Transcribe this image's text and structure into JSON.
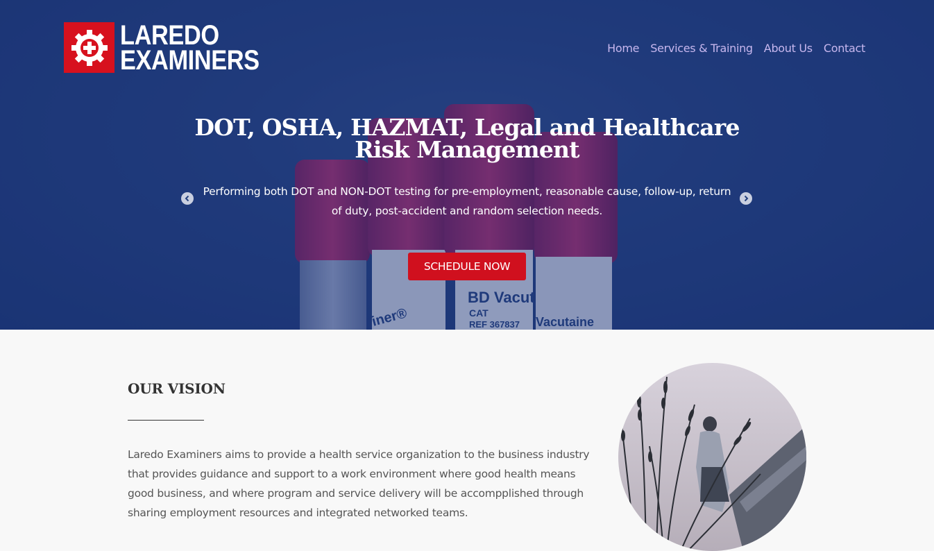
{
  "brand": {
    "line1": "LAREDO",
    "line2": "EXAMINERS",
    "mark_color": "#d7111e",
    "icon": "gear-plus-icon"
  },
  "nav": [
    {
      "label": "Home"
    },
    {
      "label": "Services & Training"
    },
    {
      "label": "About Us"
    },
    {
      "label": "Contact"
    }
  ],
  "hero": {
    "headline_line1": "DOT, OSHA, HAZMAT, Legal and Healthcare",
    "headline_line2": "Risk Management",
    "subline": "Performing both DOT and NON-DOT testing for pre-employment, reasonable cause, follow-up, return of duty, post-accident and random selection needs.",
    "cta_label": "SCHEDULE NOW",
    "cta_color": "#d0101e",
    "prev_icon": "chevron-left-icon",
    "next_icon": "chevron-right-icon",
    "bg_tubes": [
      {
        "text": "iner®"
      },
      {
        "text": "BD Vacut"
      },
      {
        "text": "CAT"
      },
      {
        "text": "REF 367837"
      },
      {
        "text": "Vacutaine"
      }
    ]
  },
  "vision": {
    "title": "OUR VISION",
    "text": "Laredo Examiners aims to provide a health service organization to the business industry that provides guidance and support to a work environment where good health means good business, and where program and service delivery will be accomppl­ished through sharing employment resources and integrated networked teams."
  }
}
